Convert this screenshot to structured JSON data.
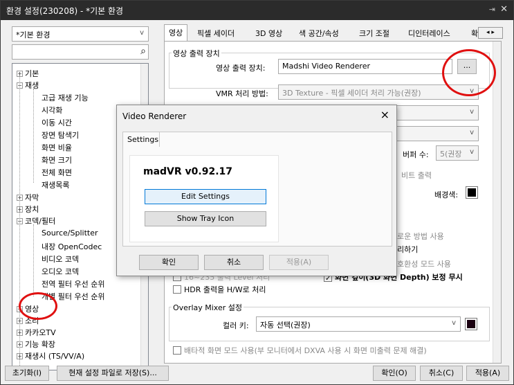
{
  "window": {
    "title": "환경 설정(230208) - *기본 환경",
    "pin_icon": "pin-icon",
    "close_label": "✕"
  },
  "profile": {
    "value": "*기본 환경"
  },
  "search": {
    "value": ""
  },
  "tree": {
    "basic": "기본",
    "playback": "재생",
    "playback_children": [
      "고급 재생 기능",
      "시각화",
      "이동 시간",
      "장면 탐색기",
      "화면 비율",
      "화면 크기",
      "전체 화면",
      "재생목록"
    ],
    "subtitle": "자막",
    "device": "장치",
    "codec": "코덱/필터",
    "codec_children": [
      "Source/Splitter",
      "내장 OpenCodec",
      "비디오 코덱",
      "오디오 코덱",
      "전역 필터 우선 순위",
      "개별 필터 우선 순위"
    ],
    "video": "영상",
    "sound": "소리",
    "kakaotv": "카카오TV",
    "feature": "기능 확장",
    "cut": "재생시 (TS/VV/A)"
  },
  "tabs": [
    "영상",
    "픽셀 세이더",
    "3D 영상",
    "색 공간/속성",
    "크기 조절",
    "디인터레이스",
    "확"
  ],
  "video_output": {
    "group": "영상 출력 장치",
    "device_label": "영상 출력 장치:",
    "device_value": "Madshi Video Renderer",
    "more_button": "...",
    "vmr_label": "VMR 처리 방법:",
    "vmr_value": "3D Texture - 픽셀 세이더 처리 가능(권장)",
    "buffer_label": "버퍼 수:",
    "buffer_value": "5(권장",
    "bit_output": "비트 출력",
    "bgcolor_label": "배경색:",
    "new_method": "로운 방법 사용",
    "do_label": "리하기",
    "compat": "호환성 모드 사용",
    "level_partial": "16~235 출력 Level 처리",
    "depth_ignore": "화면 깊이(3D 화면 Depth) 보정 무시",
    "hdr": "HDR 출력을 H/W로 처리"
  },
  "overlay": {
    "group": "Overlay Mixer 설정",
    "color_label": "컬러 키:",
    "color_value": "자동 선택(권장)",
    "exclusive": "배타적 화면 모드 사용(부 모니터에서 DXVA 사용 시 화면 미출력 문제 해결)"
  },
  "dialog": {
    "title": "Video Renderer",
    "tab": "Settings",
    "version": "madVR v0.92.17",
    "edit_button": "Edit Settings",
    "tray_button": "Show Tray Icon",
    "ok": "확인",
    "cancel": "취소",
    "apply": "적용(A)"
  },
  "bottom": {
    "reset": "초기화(I)",
    "save_as": "현재 설정 파일로 저장(S)...",
    "ok": "확인(O)",
    "cancel": "취소(C)",
    "apply": "적용(A)"
  },
  "colors": {
    "annotation": "#e01010",
    "titlebar": "#2b2b2b"
  }
}
